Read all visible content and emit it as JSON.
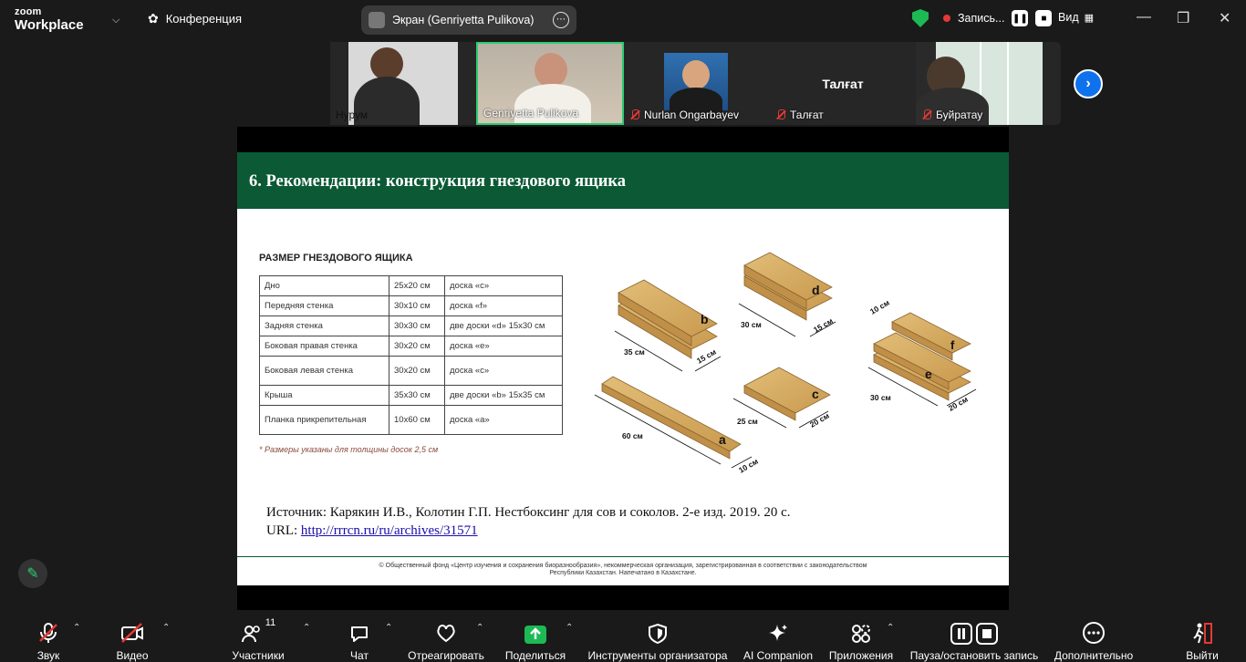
{
  "topbar": {
    "logo_line1": "zoom",
    "logo_line2": "Workplace",
    "conference_label": "Конференция",
    "screen_share_label": "Экран (Genriyetta Pulikova)",
    "recording_label": "Запись...",
    "view_label": "Вид"
  },
  "participants": [
    {
      "name": "Нурум",
      "muted": false
    },
    {
      "name": "Genriyetta Pulikova",
      "muted": false,
      "active_speaker": true
    },
    {
      "name": "Nurlan Ongarbayev",
      "muted": true
    },
    {
      "name": "Талғат",
      "muted": true,
      "display_name_large": "Талғат"
    },
    {
      "name": "Буйратау",
      "muted": true
    }
  ],
  "slide": {
    "header": "6. Рекомендации: конструкция гнездового ящика",
    "table_title": "РАЗМЕР ГНЕЗДОВОГО ЯЩИКА",
    "rows": [
      [
        "Дно",
        "25х20 см",
        "доска «с»"
      ],
      [
        "Передняя стенка",
        "30х10 см",
        "доска «f»"
      ],
      [
        "Задняя стенка",
        "30х30 см",
        "две доски «d» 15х30 см"
      ],
      [
        "Боковая правая стенка",
        "30х20 см",
        "доска «е»"
      ],
      [
        "Боковая левая стенка",
        "30х20 см",
        "доска «с»"
      ],
      [
        "Крыша",
        "35х30 см",
        "две доски «b» 15х35 см"
      ],
      [
        "Планка прикрепительная",
        "10х60 см",
        "доска «а»"
      ]
    ],
    "note": "* Размеры указаны для толщины досок 2,5 см",
    "diagram_labels": {
      "b": "b",
      "d": "d",
      "f": "f",
      "e": "e",
      "c": "c",
      "a": "a",
      "b_len": "35 см",
      "b_w": "15 см",
      "d_len": "30 см",
      "d_w": "15 см",
      "f_w": "10 см",
      "e_len": "30 см",
      "e_w": "20 см",
      "c_len": "25 см",
      "c_w": "20 см",
      "a_len": "60 см",
      "a_w": "10 см"
    },
    "source_line": "Источник: Карякин И.В., Колотин Г.П. Нестбоксинг для сов и соколов. 2-е изд. 2019. 20 с.",
    "url_prefix": "URL: ",
    "url": "http://rrrcn.ru/ru/archives/31571",
    "legal_line1": "© Общественный фонд «Центр изучения и сохранения биоразнообразия», некоммерческая организация, зарегистрированная в соответствии с законодательством",
    "legal_line2": "Республики Казахстан. Напечатано в Казахстане."
  },
  "toolbar": {
    "audio": "Звук",
    "video": "Видео",
    "participants": "Участники",
    "participants_count": "11",
    "chat": "Чат",
    "react": "Отреагировать",
    "share": "Поделиться",
    "host_tools": "Инструменты организатора",
    "ai": "AI Companion",
    "apps": "Приложения",
    "record": "Пауза/остановить запись",
    "more": "Дополнительно",
    "leave": "Выйти"
  },
  "colors": {
    "accent_green": "#2ecc71",
    "slide_header": "#0b5a35",
    "board": "#d9b36a",
    "share_green": "#1db954",
    "leave_red": "#e53935"
  }
}
